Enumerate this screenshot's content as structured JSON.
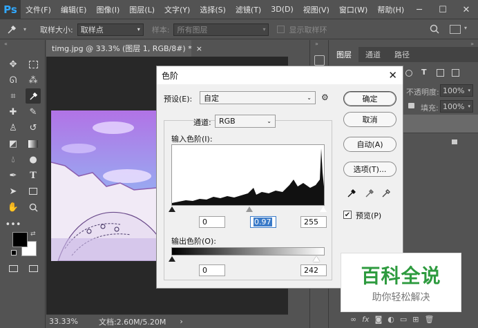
{
  "app": {
    "logo": "Ps"
  },
  "menubar": {
    "items": [
      "文件(F)",
      "编辑(E)",
      "图像(I)",
      "图层(L)",
      "文字(Y)",
      "选择(S)",
      "滤镜(T)",
      "3D(D)",
      "视图(V)",
      "窗口(W)",
      "帮助(H)"
    ],
    "window_controls": [
      "─",
      "☐",
      "✕"
    ]
  },
  "optbar": {
    "sample_size_label": "取样大小:",
    "sample_size_value": "取样点",
    "sample_label": "样本:",
    "sample_value": "所有图层",
    "show_ring_label": "显示取样环"
  },
  "document": {
    "tab_title": "timg.jpg @ 33.3% (图层 1, RGB/8#) *",
    "tab_close": "×",
    "zoom": "33.33%",
    "doc_info": "文档:2.60M/5.20M"
  },
  "right_panel": {
    "tabs": [
      "图层",
      "通道",
      "路径"
    ],
    "opacity_label": "不透明度:",
    "opacity_value": "100%",
    "fill_label": "填充:",
    "fill_value": "100%"
  },
  "levels_dialog": {
    "title": "色阶",
    "close": "✕",
    "preset_label": "预设(E):",
    "preset_value": "自定",
    "channel_label": "通道:",
    "channel_value": "RGB",
    "input_levels_label": "输入色阶(I):",
    "input_black": "0",
    "input_gamma": "0.97",
    "input_white": "255",
    "output_levels_label": "输出色阶(O):",
    "output_black": "0",
    "output_white": "242",
    "buttons": {
      "ok": "确定",
      "cancel": "取消",
      "auto": "自动(A)",
      "options": "选项(T)..."
    },
    "preview_label": "预览(P)",
    "preview_checked": true
  },
  "watermark": {
    "title": "百科全说",
    "subtitle": "助你轻松解决"
  },
  "colors": {
    "ps_blue": "#31a8ff",
    "bg_dark": "#535353",
    "canvas": "#282828",
    "watermark_green": "#2e9b3f"
  }
}
